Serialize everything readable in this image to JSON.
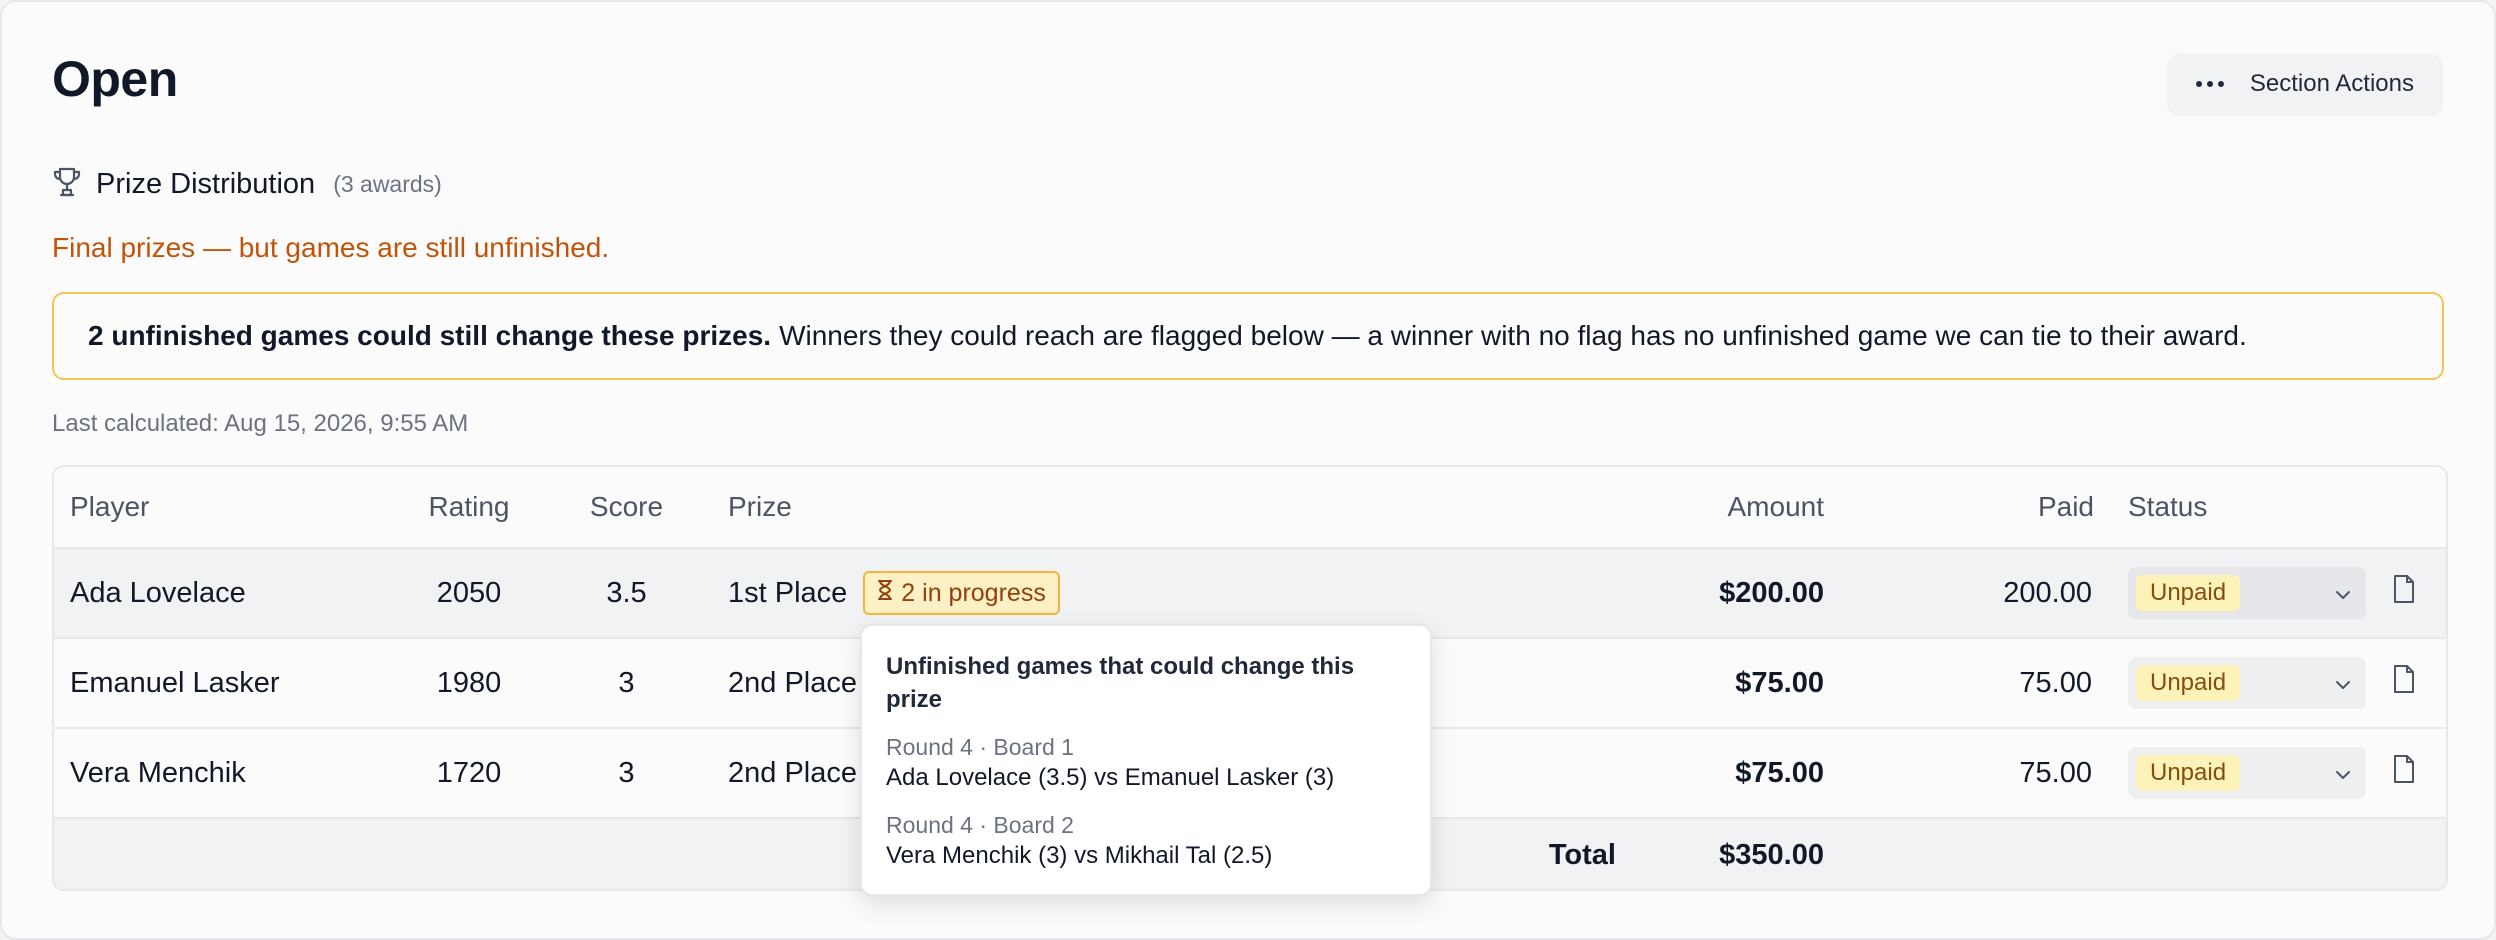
{
  "page_title": "Open",
  "section_actions_label": "Section Actions",
  "prize_section": {
    "title": "Prize Distribution",
    "count": "(3 awards)"
  },
  "warning": "Final prizes — but games are still unfinished.",
  "alert": {
    "bold": "2 unfinished games could still change these prizes.",
    "text": "Winners they could reach are flagged below — a winner with no flag has no unfinished game we can tie to their award."
  },
  "last_calculated": "Last calculated: Aug 15, 2026, 9:55 AM",
  "table": {
    "headers": {
      "player": "Player",
      "rating": "Rating",
      "score": "Score",
      "prize": "Prize",
      "amount": "Amount",
      "paid": "Paid",
      "status": "Status"
    },
    "rows": [
      {
        "player": "Ada Lovelace",
        "rating": "2050",
        "score": "3.5",
        "prize": "1st Place",
        "badge": "2 in progress",
        "amount": "$200.00",
        "paid": "200.00",
        "status": "Unpaid"
      },
      {
        "player": "Emanuel Lasker",
        "rating": "1980",
        "score": "3",
        "prize": "2nd Place",
        "amount": "$75.00",
        "paid": "75.00",
        "status": "Unpaid"
      },
      {
        "player": "Vera Menchik",
        "rating": "1720",
        "score": "3",
        "prize": "2nd Place",
        "amount": "$75.00",
        "paid": "75.00",
        "status": "Unpaid"
      }
    ],
    "total_label": "Total",
    "total_amount": "$350.00"
  },
  "popover": {
    "title": "Unfinished games that could change this prize",
    "games": [
      {
        "round": "Round 4 · Board 1",
        "match": "Ada Lovelace (3.5) vs Emanuel Lasker (3)"
      },
      {
        "round": "Round 4 · Board 2",
        "match": "Vera Menchik (3) vs Mikhail Tal (2.5)"
      }
    ]
  },
  "colors": {
    "warning": "#c2530a",
    "alert_border": "#f5c35a",
    "badge_bg": "#fdf0c4",
    "status_pill_bg": "#fdf3b8"
  }
}
